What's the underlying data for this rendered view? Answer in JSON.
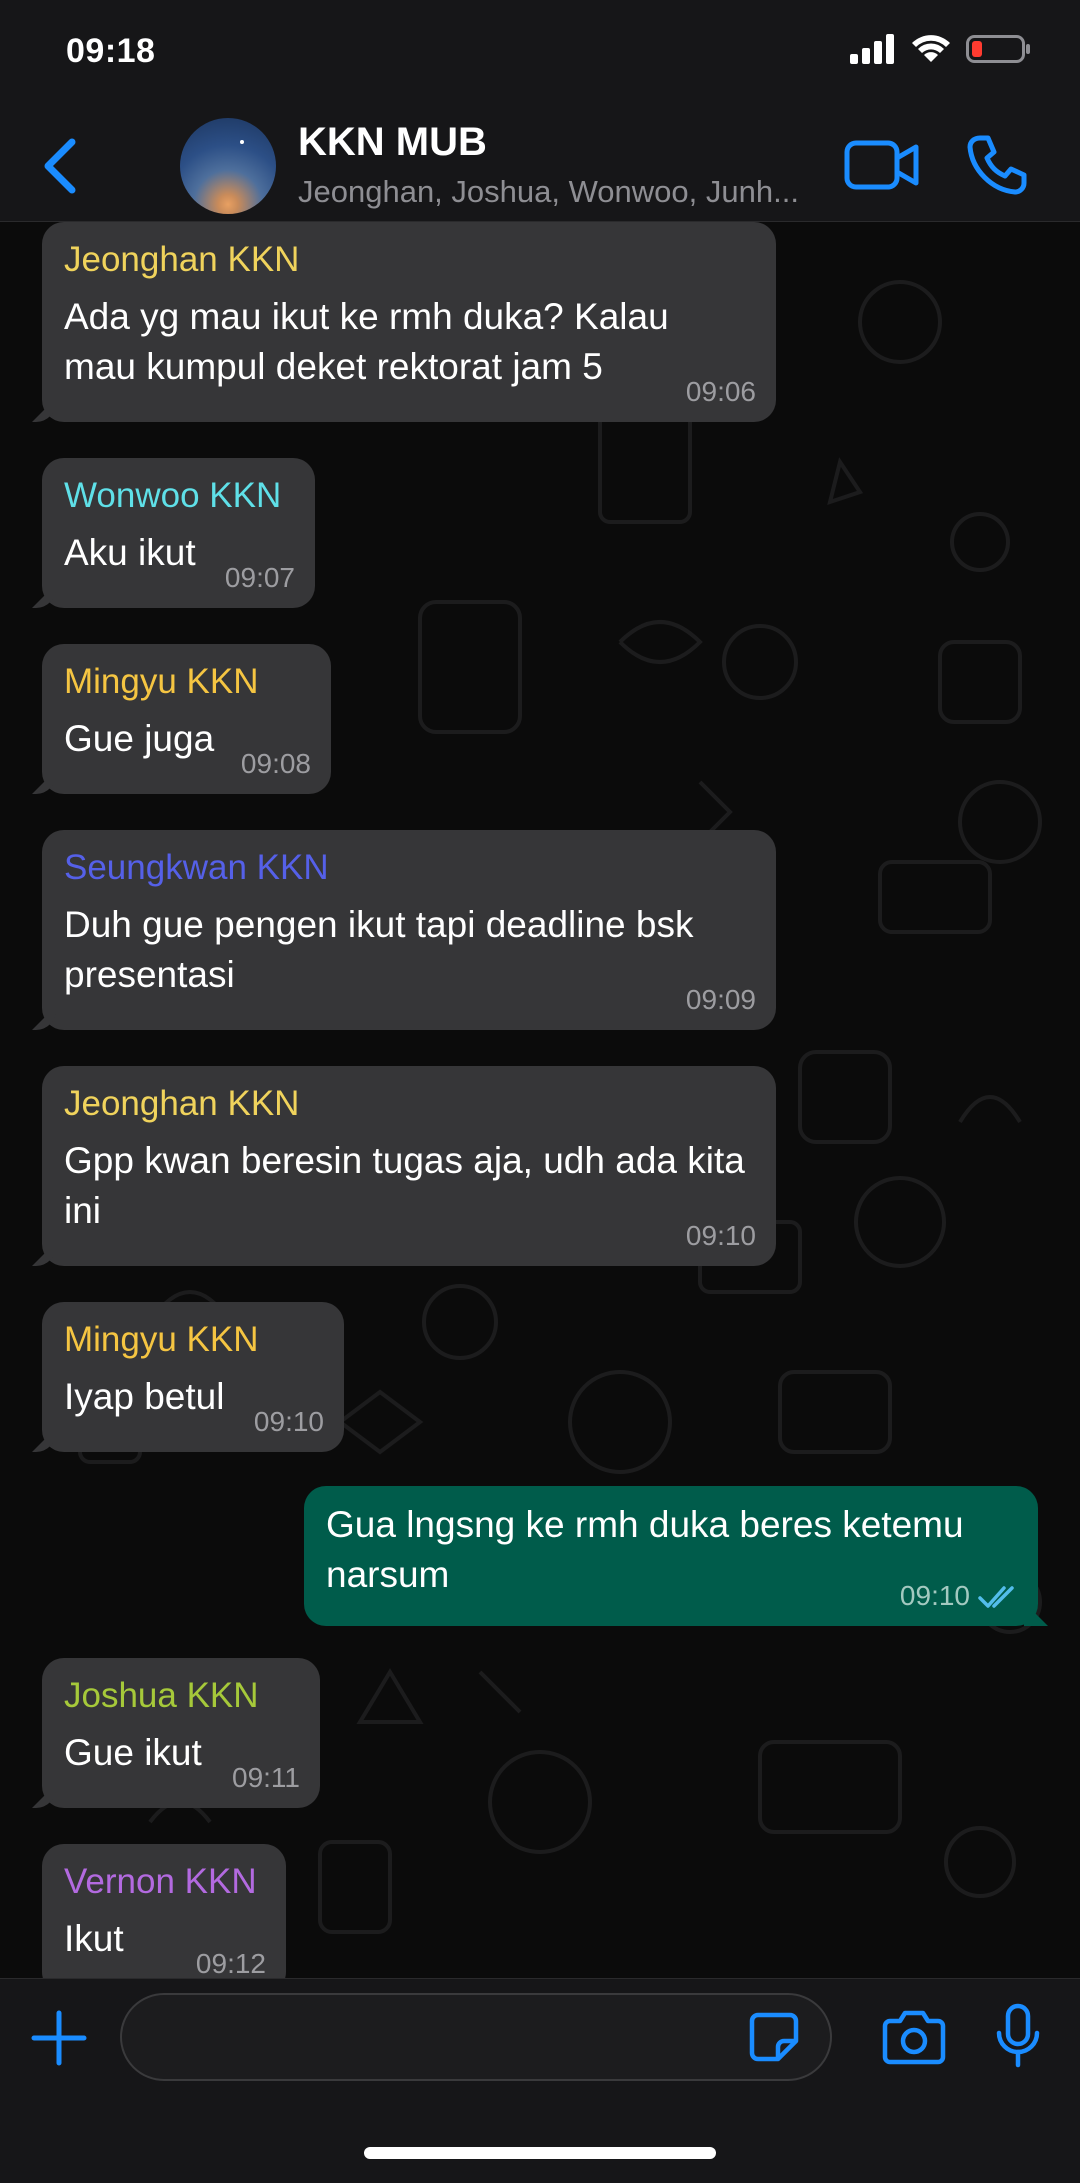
{
  "status_bar": {
    "time": "09:18",
    "icons": [
      "cellular-signal-icon",
      "wifi-icon",
      "battery-low-icon"
    ]
  },
  "header": {
    "back_icon": "chevron-left-icon",
    "title": "KKN MUB",
    "subtitle": "Jeonghan, Joshua, Wonwoo, Junh...",
    "video_icon": "video-camera-icon",
    "call_icon": "phone-icon"
  },
  "messages": [
    {
      "direction": "in",
      "sender": "Jeonghan KKN",
      "sender_color": "#f0d35c",
      "text": "Ada yg mau ikut ke rmh duka? Kalau mau kumpul deket rektorat jam 5",
      "time": "09:06"
    },
    {
      "direction": "in",
      "sender": "Wonwoo KKN",
      "sender_color": "#5fe0e8",
      "text": "Aku ikut",
      "time": "09:07"
    },
    {
      "direction": "in",
      "sender": "Mingyu KKN",
      "sender_color": "#f5c542",
      "text": "Gue juga",
      "time": "09:08"
    },
    {
      "direction": "in",
      "sender": "Seungkwan KKN",
      "sender_color": "#5560e8",
      "text": "Duh gue pengen ikut tapi deadline bsk presentasi",
      "time": "09:09"
    },
    {
      "direction": "in",
      "sender": "Jeonghan KKN",
      "sender_color": "#f0d35c",
      "text": "Gpp kwan beresin tugas aja, udh ada kita ini",
      "time": "09:10"
    },
    {
      "direction": "in",
      "sender": "Mingyu KKN",
      "sender_color": "#f5c542",
      "text": "Iyap betul",
      "time": "09:10"
    },
    {
      "direction": "out",
      "sender": "",
      "sender_color": "",
      "text": "Gua lngsng ke rmh duka beres ketemu narsum",
      "time": "09:10",
      "status": "read"
    },
    {
      "direction": "in",
      "sender": "Joshua KKN",
      "sender_color": "#a6c93a",
      "text": "Gue ikut",
      "time": "09:11"
    },
    {
      "direction": "in",
      "sender": "Vernon KKN",
      "sender_color": "#b36ae0",
      "text": "Ikut",
      "time": "09:12"
    }
  ],
  "input_bar": {
    "plus_icon": "plus-icon",
    "placeholder": "",
    "sticker_icon": "sticker-icon",
    "camera_icon": "camera-icon",
    "mic_icon": "microphone-icon"
  },
  "colors": {
    "accent": "#1a8cff",
    "incoming_bubble": "#363638",
    "outgoing_bubble": "#005c4b",
    "background": "#0b0b0b"
  }
}
